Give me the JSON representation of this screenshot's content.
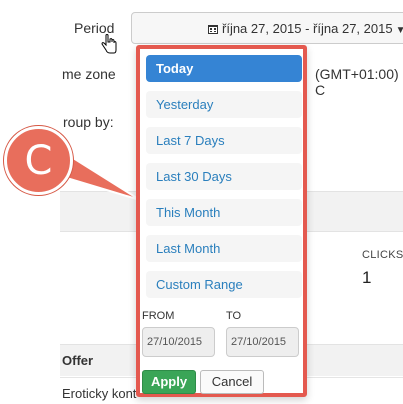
{
  "form": {
    "period_label": "Period",
    "timezone_label": "me zone",
    "timezone_value": "(GMT+01:00) C",
    "group_by_label": "roup by:",
    "date_range_display": "října 27, 2015 - října 27, 2015"
  },
  "table": {
    "clicks_header": "CLICKS",
    "clicks_value": "1",
    "offer_header": "Offer",
    "offer_row_text": "Eroticky kont"
  },
  "callout": {
    "letter": "C",
    "color": "#e86e5c"
  },
  "picker": {
    "ranges": [
      {
        "label": "Today",
        "active": true
      },
      {
        "label": "Yesterday",
        "active": false
      },
      {
        "label": "Last 7 Days",
        "active": false
      },
      {
        "label": "Last 30 Days",
        "active": false
      },
      {
        "label": "This Month",
        "active": false
      },
      {
        "label": "Last Month",
        "active": false
      },
      {
        "label": "Custom Range",
        "active": false
      }
    ],
    "from_label": "FROM",
    "to_label": "TO",
    "from_value": "27/10/2015",
    "to_value": "27/10/2015",
    "apply_label": "Apply",
    "cancel_label": "Cancel",
    "highlight_color": "#e4594f",
    "active_color": "#3584d4",
    "apply_color": "#3aa557"
  }
}
